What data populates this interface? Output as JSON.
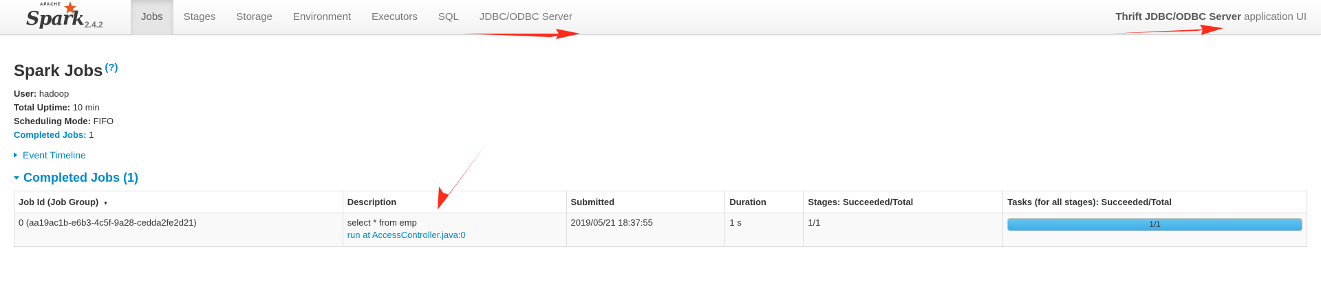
{
  "brand": {
    "apache": "APACHE",
    "name": "Spark",
    "version": "2.4.2"
  },
  "nav": {
    "tabs": [
      {
        "label": "Jobs",
        "active": true
      },
      {
        "label": "Stages",
        "active": false
      },
      {
        "label": "Storage",
        "active": false
      },
      {
        "label": "Environment",
        "active": false
      },
      {
        "label": "Executors",
        "active": false
      },
      {
        "label": "SQL",
        "active": false
      },
      {
        "label": "JDBC/ODBC Server",
        "active": false
      }
    ],
    "app_name_bold": "Thrift JDBC/ODBC Server",
    "app_name_suffix": " application UI"
  },
  "page": {
    "title": "Spark Jobs",
    "help": "(?)",
    "summary": {
      "user_label": "User:",
      "user_value": " hadoop",
      "uptime_label": "Total Uptime:",
      "uptime_value": " 10 min",
      "mode_label": "Scheduling Mode:",
      "mode_value": " FIFO",
      "completed_label": "Completed Jobs:",
      "completed_value": " 1"
    },
    "event_timeline": "Event Timeline",
    "completed_section": "Completed Jobs (1)"
  },
  "table": {
    "headers": {
      "job_id": "Job Id (Job Group)",
      "sort_indicator": "▾",
      "description": "Description",
      "submitted": "Submitted",
      "duration": "Duration",
      "stages": "Stages: Succeeded/Total",
      "tasks": "Tasks (for all stages): Succeeded/Total"
    },
    "rows": [
      {
        "job_id": "0 (aa19ac1b-e6b3-4c5f-9a28-cedda2fe2d21)",
        "description": "select * from emp",
        "description_link": "run at AccessController.java:0",
        "submitted": "2019/05/21 18:37:55",
        "duration": "1 s",
        "stages": "1/1",
        "tasks_label": "1/1",
        "tasks_progress": 1.0
      }
    ]
  },
  "colors": {
    "link": "#0088cc",
    "progress": "#3aaee8",
    "annotation": "#ff2a1a"
  },
  "icons": {
    "star": "spark-star-icon",
    "help": "help-icon"
  }
}
